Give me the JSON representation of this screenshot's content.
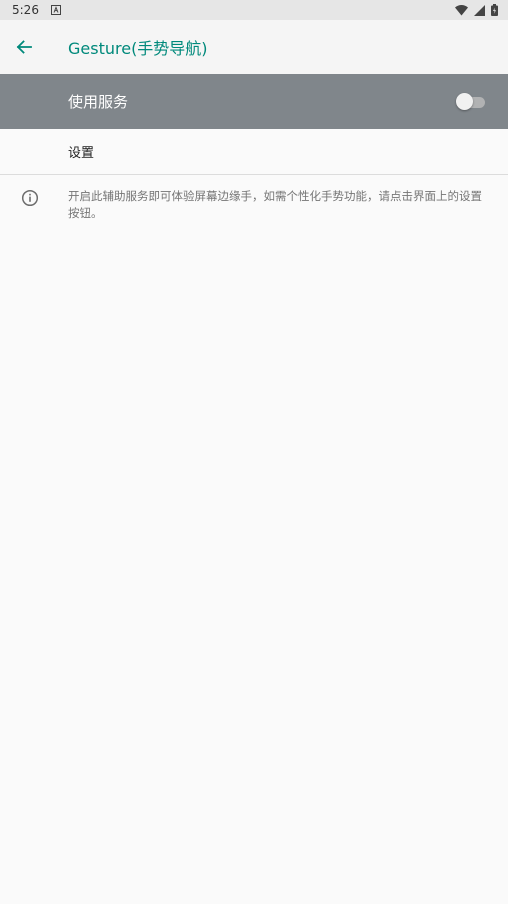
{
  "status_bar": {
    "time": "5:26",
    "icons": [
      "notification-a-icon",
      "wifi-icon",
      "signal-icon",
      "battery-icon"
    ]
  },
  "app_bar": {
    "title": "Gesture(手势导航)",
    "back_icon": "arrow-back-icon",
    "accent_color": "#00897b"
  },
  "master_switch": {
    "label": "使用服务",
    "checked": false,
    "background_color": "#80868b"
  },
  "settings_item": {
    "label": "设置"
  },
  "info": {
    "icon": "info-icon",
    "text": "开启此辅助服务即可体验屏幕边缘手，如需个性化手势功能，请点击界面上的设置按钮。"
  }
}
